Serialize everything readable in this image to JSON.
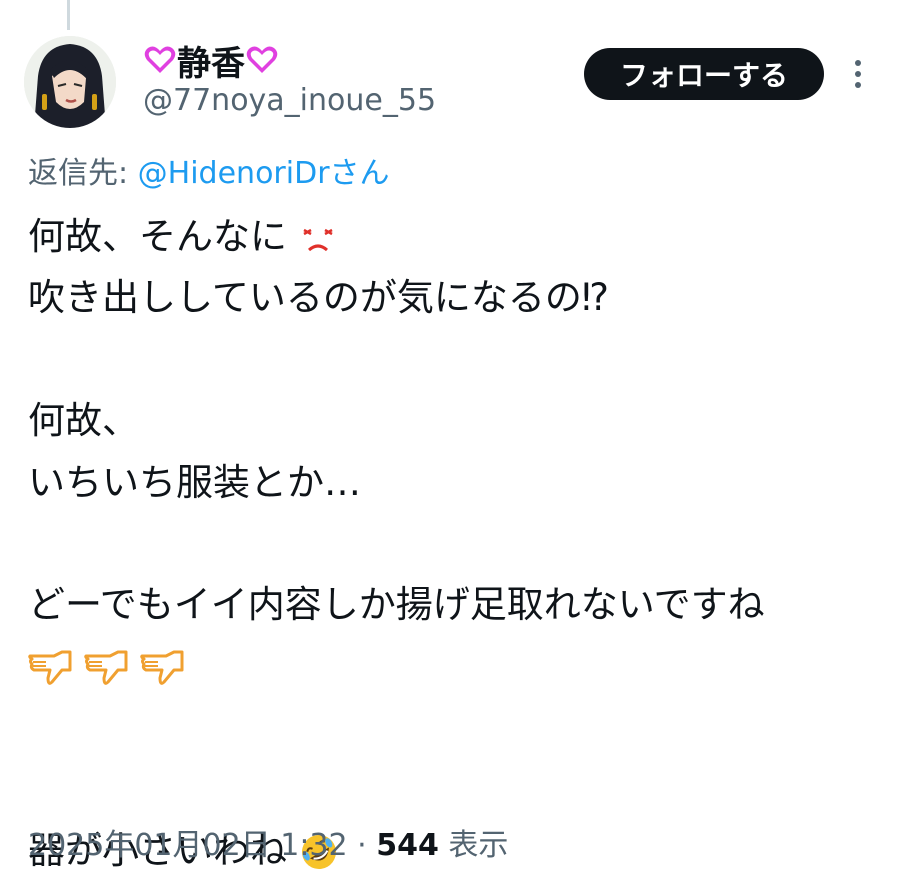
{
  "author": {
    "display_name": "静香",
    "handle": "@77noya_inoue_55",
    "name_emoji": "heart-icon"
  },
  "follow_button": {
    "label": "フォローする"
  },
  "reply_context": {
    "prefix": "返信先: ",
    "mention": "@HidenoriDrさん"
  },
  "tweet": {
    "lines": [
      "何故、そんなに",
      "吹き出ししているのが気になるの⁉",
      "",
      "何故、",
      "いちいち服装とか…",
      "",
      "どーでもイイ内容しか揚げ足取れないですね",
      "",
      "",
      "器が小さいわね"
    ],
    "emojis": {
      "line1": "pouting-face-icon",
      "line8": "thumbs-down-icon",
      "line10": "rolling-on-floor-laughing-icon"
    }
  },
  "meta": {
    "timestamp": "2025年01月02日 1:32",
    "separator": " · ",
    "views_count": "544",
    "views_label": "表示"
  },
  "colors": {
    "text": "#0f1419",
    "secondary": "#536471",
    "link": "#1d9bf0",
    "heart": "#e040e0",
    "thumb": "#f0a030"
  }
}
